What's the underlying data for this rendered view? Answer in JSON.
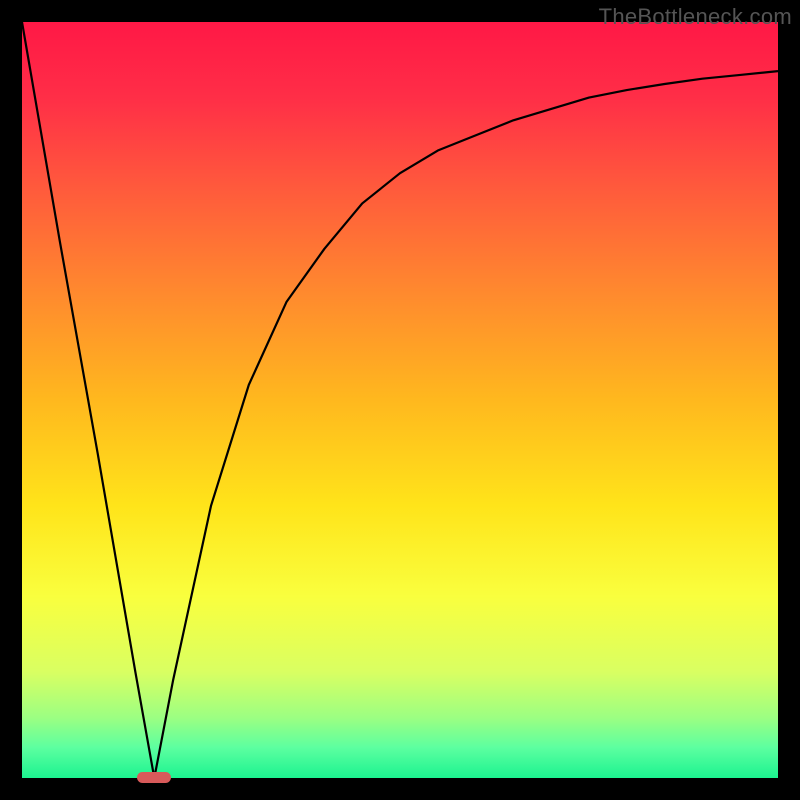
{
  "watermark": "TheBottleneck.com",
  "colors": {
    "curve": "#000000",
    "marker": "#d85a5a",
    "frame": "#000000"
  },
  "chart_data": {
    "type": "line",
    "title": "",
    "xlabel": "",
    "ylabel": "",
    "xlim": [
      0,
      100
    ],
    "ylim": [
      0,
      100
    ],
    "series": [
      {
        "name": "bottleneck-curve",
        "x": [
          0,
          5,
          10,
          15,
          17.5,
          20,
          25,
          30,
          35,
          40,
          45,
          50,
          55,
          60,
          65,
          70,
          75,
          80,
          85,
          90,
          95,
          100
        ],
        "y": [
          100,
          71,
          43,
          14,
          0,
          13,
          36,
          52,
          63,
          70,
          76,
          80,
          83,
          85,
          87,
          88.5,
          90,
          91,
          91.8,
          92.5,
          93,
          93.5
        ]
      }
    ],
    "annotations": [
      {
        "name": "min-marker",
        "x": 17.5,
        "y": 0,
        "shape": "pill"
      }
    ]
  }
}
